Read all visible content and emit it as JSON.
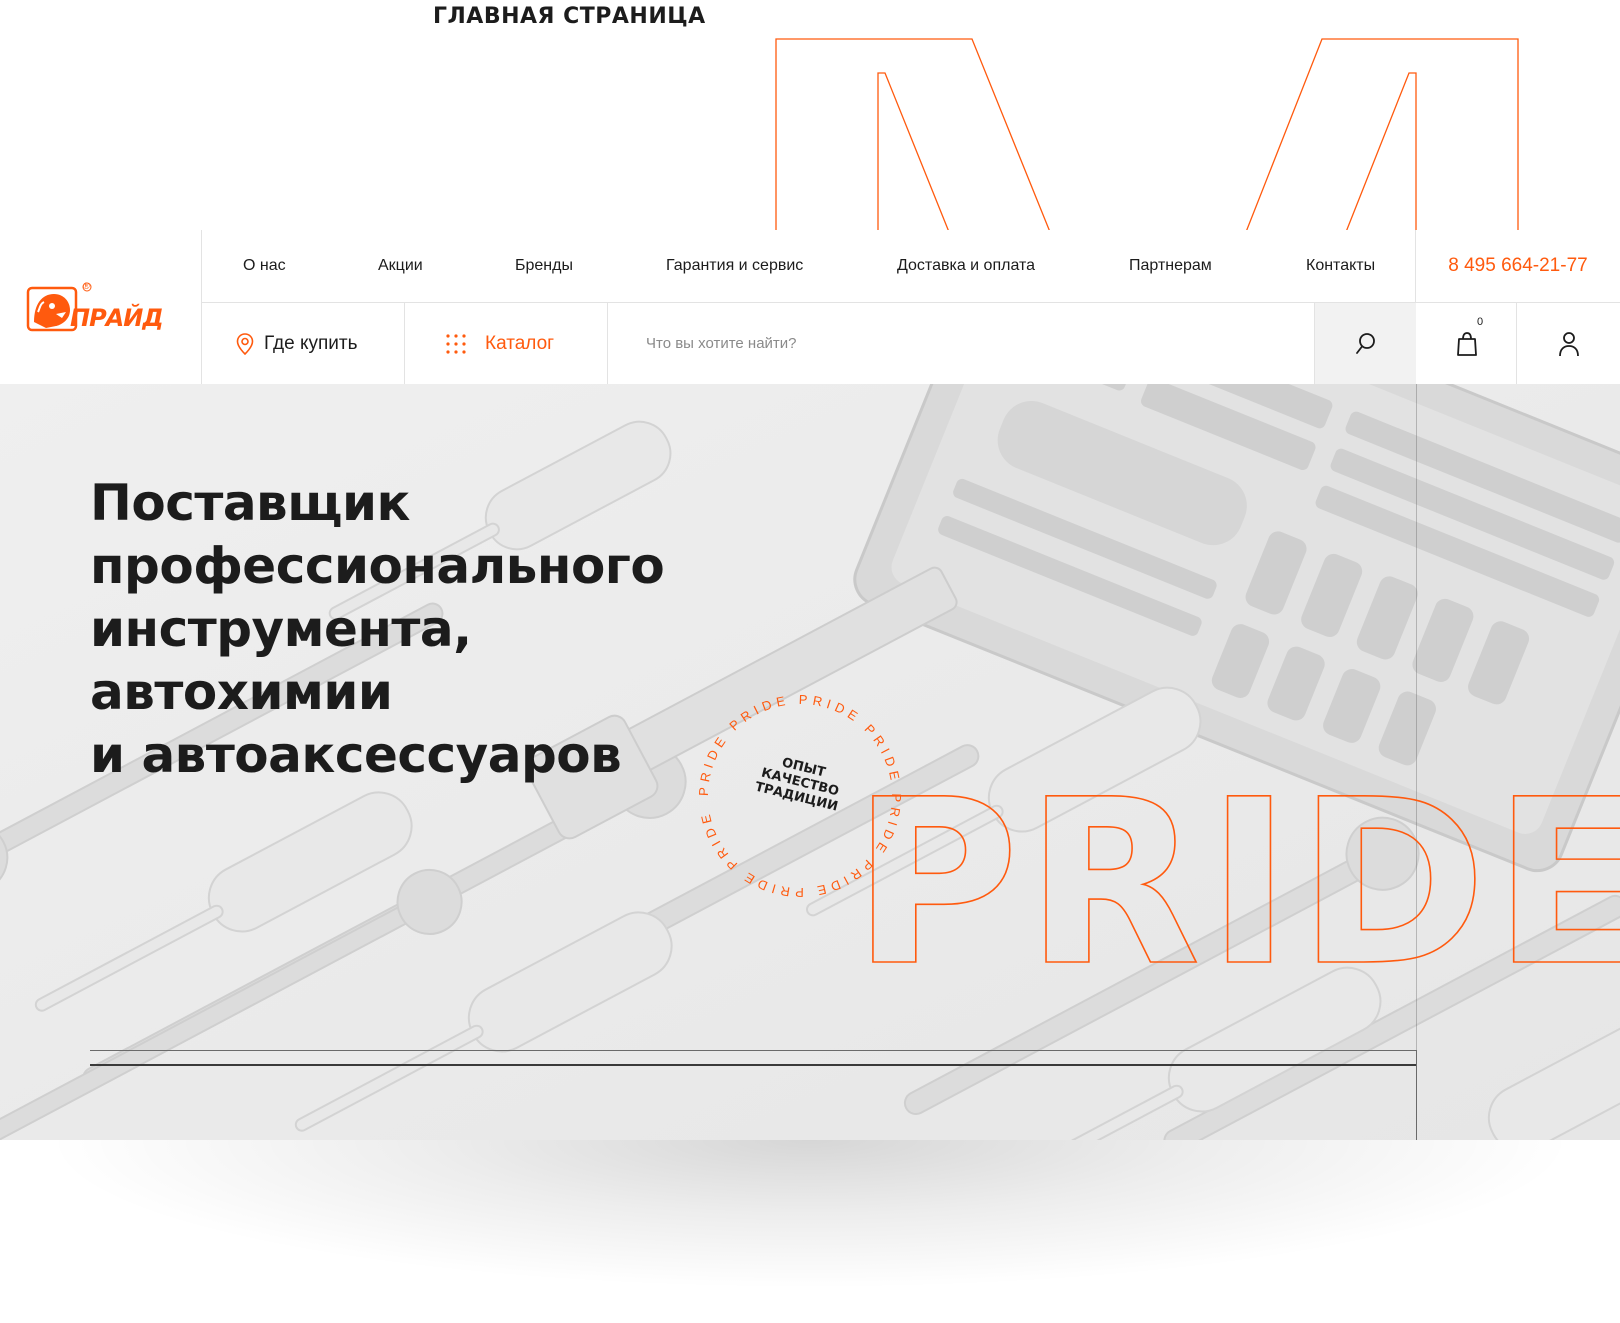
{
  "page_heading": "ГЛАВНАЯ СТРАНИЦА",
  "colors": {
    "accent": "#ff5a0e",
    "text": "#1c1c1c",
    "hero_bg": "#ececec"
  },
  "logo": {
    "text": "ПРАЙД",
    "registered": "®",
    "icon": "lion-head-icon"
  },
  "nav": {
    "items": [
      {
        "label": "О нас"
      },
      {
        "label": "Акции"
      },
      {
        "label": "Бренды"
      },
      {
        "label": "Гарантия и сервис"
      },
      {
        "label": "Доставка и оплата"
      },
      {
        "label": "Партнерам"
      },
      {
        "label": "Контакты"
      }
    ],
    "phone": "8 495 664-21-77"
  },
  "toolbar": {
    "where_to_buy": {
      "label": "Где купить",
      "icon": "location-pin-icon"
    },
    "catalog": {
      "label": "Каталог",
      "icon": "grid-dots-icon"
    },
    "search": {
      "placeholder": "Что вы хотите найти?",
      "icon": "search-icon"
    },
    "cart": {
      "count": "0",
      "icon": "shopping-bag-icon"
    },
    "user": {
      "icon": "user-icon"
    }
  },
  "hero": {
    "title_lines": [
      "Поставщик",
      "профессионального",
      "инструмента,",
      "автохимии",
      "и автоаксессуаров"
    ],
    "stamp": {
      "ring_text": "PRIDE PRIDE PRIDE PRIDE PRIDE PRIDE PRIDE PRIDE",
      "center_lines": [
        "ОПЫТ",
        "КАЧЕСТВО",
        "ТРАДИЦИИ"
      ]
    },
    "big_word": "PRIDE"
  }
}
